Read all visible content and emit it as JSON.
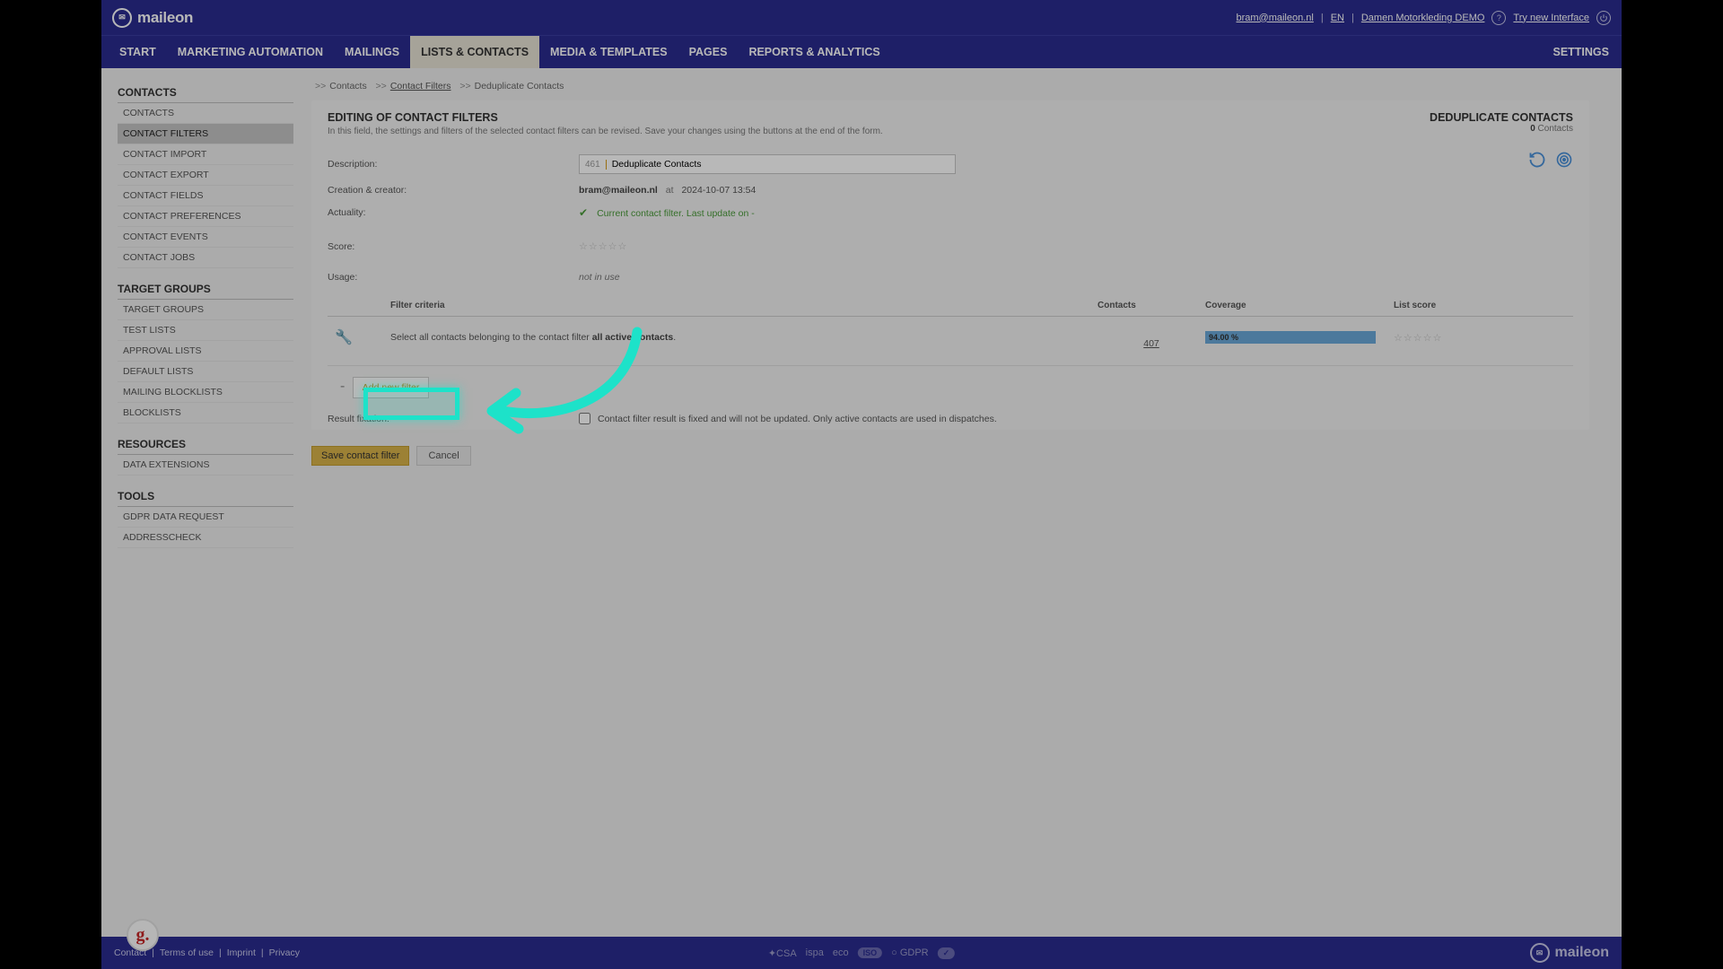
{
  "brand": "maileon",
  "header": {
    "user_email": "bram@maileon.nl",
    "lang": "EN",
    "account": "Damen Motorkleding DEMO",
    "try_new": "Try new Interface"
  },
  "nav": {
    "items": [
      "START",
      "MARKETING AUTOMATION",
      "MAILINGS",
      "LISTS & CONTACTS",
      "MEDIA & TEMPLATES",
      "PAGES",
      "REPORTS & ANALYTICS"
    ],
    "active": "LISTS & CONTACTS",
    "settings": "SETTINGS"
  },
  "sidebar": {
    "groups": [
      {
        "title": "CONTACTS",
        "items": [
          "CONTACTS",
          "CONTACT FILTERS",
          "CONTACT IMPORT",
          "CONTACT EXPORT",
          "CONTACT FIELDS",
          "CONTACT PREFERENCES",
          "CONTACT EVENTS",
          "CONTACT JOBS"
        ],
        "active": "CONTACT FILTERS"
      },
      {
        "title": "TARGET GROUPS",
        "items": [
          "TARGET GROUPS",
          "TEST LISTS",
          "APPROVAL LISTS",
          "DEFAULT LISTS",
          "MAILING BLOCKLISTS",
          "BLOCKLISTS"
        ]
      },
      {
        "title": "RESOURCES",
        "items": [
          "DATA EXTENSIONS"
        ]
      },
      {
        "title": "TOOLS",
        "items": [
          "GDPR DATA REQUEST",
          "ADDRESSCHECK"
        ]
      }
    ]
  },
  "crumbs": {
    "c1": "Contacts",
    "c2": "Contact Filters",
    "c3": "Deduplicate Contacts"
  },
  "panel": {
    "title": "EDITING OF CONTACT FILTERS",
    "subtitle": "In this field, the settings and filters of the selected contact filters can be revised. Save your changes using the buttons at the end of the form.",
    "right_title": "DEDUPLICATE CONTACTS",
    "right_count": "0",
    "right_count_label": "Contacts"
  },
  "form": {
    "desc_label": "Description:",
    "desc_id": "461",
    "desc_value": "Deduplicate Contacts",
    "creator_label": "Creation & creator:",
    "creator": "bram@maileon.nl",
    "at": "at",
    "created_at": "2024-10-07 13:54",
    "actuality_label": "Actuality:",
    "actuality_text": "Current contact filter. Last update on -",
    "score_label": "Score:",
    "usage_label": "Usage:",
    "usage_value": "not in use"
  },
  "table": {
    "h_criteria": "Filter criteria",
    "h_contacts": "Contacts",
    "h_coverage": "Coverage",
    "h_listscore": "List score",
    "row_text_pre": "Select all contacts belonging to the contact filter ",
    "row_text_bold": "all active contacts",
    "row_text_post": ".",
    "contacts": "407",
    "coverage": "94.00 %"
  },
  "buttons": {
    "add_filter": "Add new filter",
    "result_fix_label": "Result fixation:",
    "result_fix_desc": "Contact filter result is fixed and will not be updated. Only active contacts are used in dispatches.",
    "save": "Save contact filter",
    "cancel": "Cancel"
  },
  "footer": {
    "links": [
      "Contact",
      "Terms of use",
      "Imprint",
      "Privacy"
    ],
    "certs": [
      "CSA",
      "ispa",
      "eco",
      "ISO",
      "GDPR"
    ]
  }
}
